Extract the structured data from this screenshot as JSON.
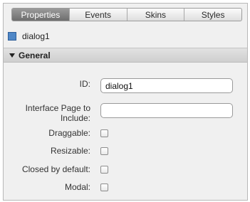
{
  "tabs": [
    {
      "label": "Properties",
      "active": true
    },
    {
      "label": "Events",
      "active": false
    },
    {
      "label": "Skins",
      "active": false
    },
    {
      "label": "Styles",
      "active": false
    }
  ],
  "element": {
    "name": "dialog1",
    "icon": "dialog-icon"
  },
  "section": {
    "title": "General",
    "expanded": true
  },
  "fields": {
    "id": {
      "label": "ID:",
      "value": "dialog1"
    },
    "interface_page": {
      "label_line1": "Interface Page to",
      "label_line2": "Include:",
      "value": ""
    },
    "draggable": {
      "label": "Draggable:",
      "checked": false
    },
    "resizable": {
      "label": "Resizable:",
      "checked": false
    },
    "closed_by_default": {
      "label": "Closed by default:",
      "checked": false
    },
    "modal": {
      "label": "Modal:",
      "checked": false
    }
  }
}
